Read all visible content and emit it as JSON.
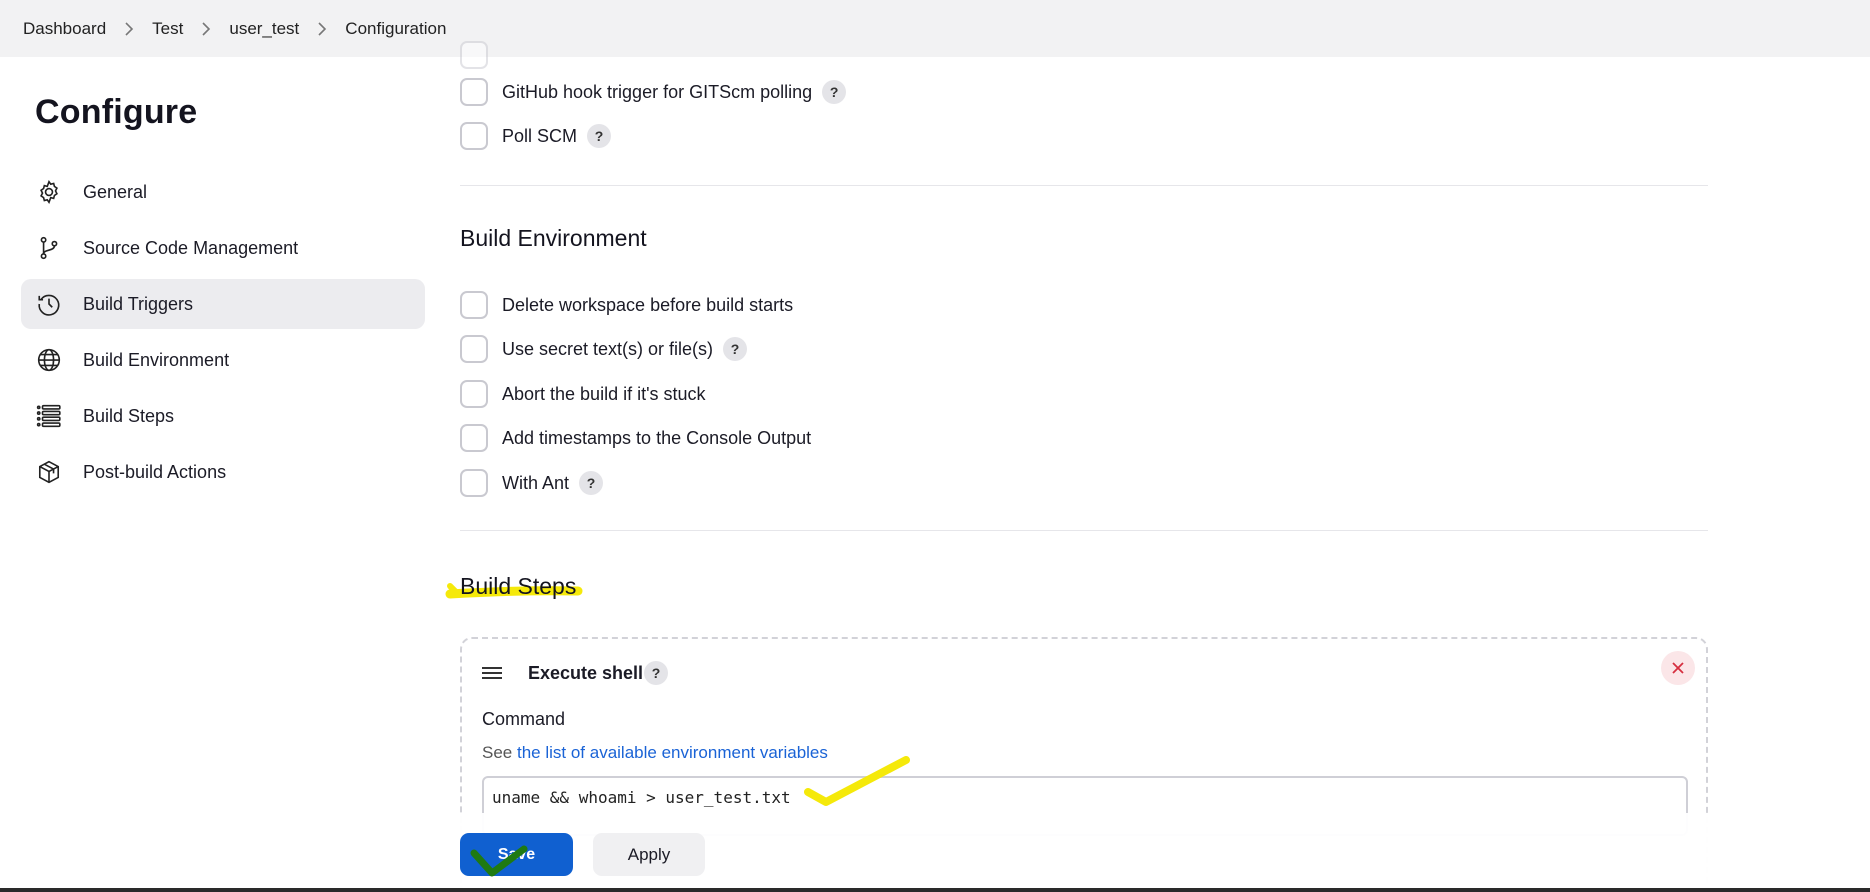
{
  "breadcrumb": {
    "items": [
      "Dashboard",
      "Test",
      "user_test",
      "Configuration"
    ]
  },
  "sidebar": {
    "title": "Configure",
    "items": [
      {
        "label": "General",
        "icon": "gear-icon"
      },
      {
        "label": "Source Code Management",
        "icon": "branch-icon"
      },
      {
        "label": "Build Triggers",
        "icon": "clock-icon",
        "active": true
      },
      {
        "label": "Build Environment",
        "icon": "globe-icon"
      },
      {
        "label": "Build Steps",
        "icon": "list-icon"
      },
      {
        "label": "Post-build Actions",
        "icon": "package-icon"
      }
    ]
  },
  "triggers": {
    "items": [
      {
        "label": "GitHub hook trigger for GITScm polling",
        "help": "?"
      },
      {
        "label": "Poll SCM",
        "help": "?"
      }
    ]
  },
  "build_environment": {
    "title": "Build Environment",
    "items": [
      {
        "label": "Delete workspace before build starts"
      },
      {
        "label": "Use secret text(s) or file(s)",
        "help": "?"
      },
      {
        "label": "Abort the build if it's stuck"
      },
      {
        "label": "Add timestamps to the Console Output"
      },
      {
        "label": "With Ant",
        "help": "?"
      }
    ]
  },
  "build_steps": {
    "title": "Build Steps",
    "step": {
      "title": "Execute shell",
      "help": "?",
      "command_label": "Command",
      "see_prefix": "See",
      "see_link": "the list of available environment variables",
      "command_value": "uname && whoami > user_test.txt"
    }
  },
  "actions": {
    "save_label": "Save",
    "apply_label": "Apply"
  },
  "colors": {
    "accent": "#1060d0",
    "link": "#1a63d6",
    "highlight": "#f5e90a",
    "check_mark": "#1f7a12"
  }
}
